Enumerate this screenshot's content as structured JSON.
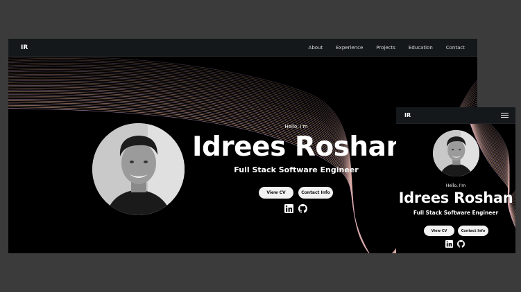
{
  "desktop": {
    "logo": "IR",
    "menu": [
      "About",
      "Experience",
      "Projects",
      "Education",
      "Contact"
    ]
  },
  "hero": {
    "greeting": "Hello, I'm",
    "name": "Idrees Roshan",
    "role": "Full Stack Software Engineer",
    "view_cv": "View CV",
    "contact_info": "Contact Info"
  },
  "mobile": {
    "logo": "IR",
    "menu_icon": "hamburger-icon"
  },
  "social_icons": [
    "linkedin-icon",
    "github-icon"
  ],
  "colors": {
    "page_bg": "#3b3b3b",
    "hero_bg": "#000000",
    "nav_bg": "#15181b",
    "wave": "#e8b39a"
  }
}
